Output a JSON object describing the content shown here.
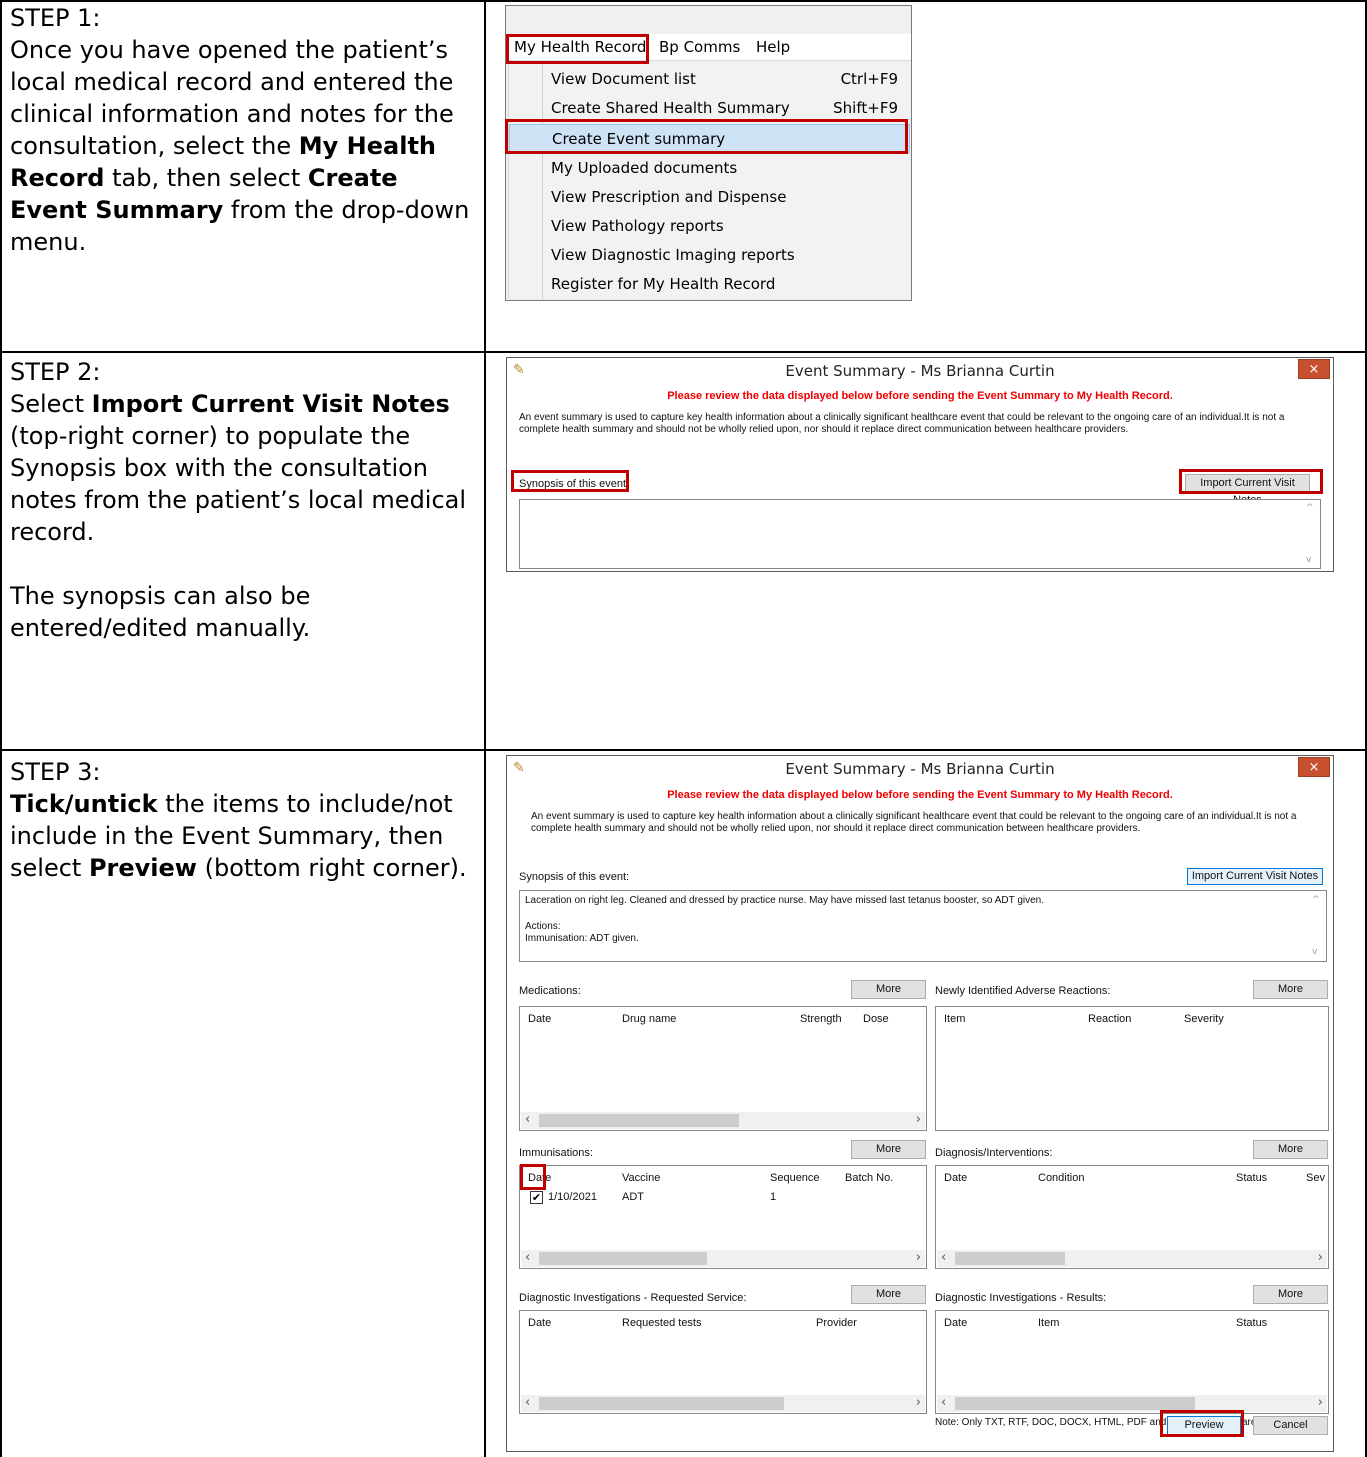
{
  "steps": [
    {
      "heading": "STEP 1:",
      "text_parts": [
        "Once you have opened the patient’s local medical record and entered the clinical information and notes for the consultation, select the ",
        "My Health Record",
        " tab, then select ",
        "Create Event Summary",
        " from the drop-down menu."
      ]
    },
    {
      "heading": "STEP 2:",
      "text_parts": [
        "Select ",
        "Import Current Visit Notes",
        " (top-right corner) to populate the Synopsis box with the consultation notes from the patient’s local medical record."
      ],
      "extra": "The synopsis can also be entered/edited manually."
    },
    {
      "heading": "STEP 3:",
      "text_parts": [
        "Tick/untick",
        " the items to include/not include in the Event Summary, then select ",
        "Preview",
        " (bottom right corner)."
      ]
    }
  ],
  "menu": {
    "bar": [
      "My Health Record",
      "Bp Comms",
      "Help"
    ],
    "items": [
      {
        "label": "View Document list",
        "shortcut": "Ctrl+F9"
      },
      {
        "label": "Create Shared Health Summary",
        "shortcut": "Shift+F9"
      },
      {
        "label": "Create Event summary",
        "shortcut": ""
      },
      {
        "label": "My Uploaded documents",
        "shortcut": ""
      },
      {
        "label": "View Prescription and Dispense",
        "shortcut": ""
      },
      {
        "label": "View Pathology reports",
        "shortcut": ""
      },
      {
        "label": "View Diagnostic Imaging reports",
        "shortcut": ""
      },
      {
        "label": "Register for My Health Record",
        "shortcut": ""
      }
    ]
  },
  "dialog": {
    "title": "Event Summary - Ms Brianna Curtin",
    "close_glyph": "×",
    "warning": "Please review the data displayed below before sending the Event Summary to My Health Record.",
    "description": "An event summary is used to capture key health information about a clinically significant healthcare event that could be relevant to the ongoing care of an individual.It is not a complete health summary and should not be wholly relied upon, nor should it replace direct communication between healthcare providers.",
    "synopsis_label": "Synopsis of this event:",
    "import_button": "Import Current Visit Notes",
    "synopsis_lines": [
      "Laceration on right leg. Cleaned and dressed by practice nurse. May have missed last tetanus booster, so ADT given.",
      "",
      "Actions:",
      "Immunisation: ADT given."
    ],
    "more_label": "More",
    "sections": {
      "medications": {
        "label": "Medications:",
        "columns": [
          "Date",
          "Drug name",
          "Strength",
          "Dose"
        ]
      },
      "reactions": {
        "label": "Newly Identified Adverse Reactions:",
        "columns": [
          "Item",
          "Reaction",
          "Severity"
        ]
      },
      "immunisations": {
        "label": "Immunisations:",
        "columns": [
          "Date",
          "Vaccine",
          "Sequence",
          "Batch No."
        ],
        "row": {
          "date": "1/10/2021",
          "vaccine": "ADT",
          "sequence": "1",
          "checked": true,
          "check_glyph": "✔"
        }
      },
      "diagnosis": {
        "label": "Diagnosis/Interventions:",
        "columns": [
          "Date",
          "Condition",
          "Status",
          "Sev"
        ]
      },
      "requested": {
        "label": "Diagnostic Investigations - Requested Service:",
        "columns": [
          "Date",
          "Requested tests",
          "Provider"
        ]
      },
      "results": {
        "label": "Diagnostic Investigations - Results:",
        "columns": [
          "Date",
          "Item",
          "Status"
        ]
      }
    },
    "note": "Note: Only TXT, RTF, DOC, DOCX, HTML, PDF and Image file types are supported.",
    "preview_button": "Preview",
    "cancel_button": "Cancel"
  },
  "colors": {
    "highlight": "#c00000",
    "warning": "#ee0000"
  },
  "icons": {
    "title_icon": "feather-icon",
    "scroll_left": "‹",
    "scroll_right": "›",
    "scroll_up": "^",
    "scroll_down": "v"
  }
}
